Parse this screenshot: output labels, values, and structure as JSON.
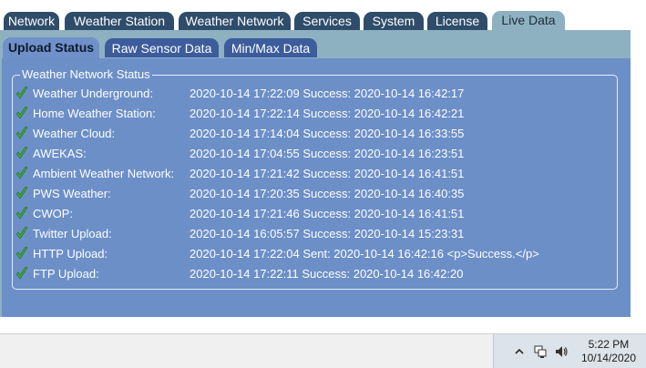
{
  "top_tabs": [
    {
      "label": "Network"
    },
    {
      "label": "Weather Station"
    },
    {
      "label": "Weather Network"
    },
    {
      "label": "Services"
    },
    {
      "label": "System"
    },
    {
      "label": "License"
    },
    {
      "label": "Live Data"
    }
  ],
  "active_top_tab": "Live Data",
  "sub_tabs": [
    {
      "label": "Upload Status"
    },
    {
      "label": "Raw Sensor Data"
    },
    {
      "label": "Min/Max Data"
    }
  ],
  "active_sub_tab": "Upload Status",
  "status": {
    "legend": "Weather Network Status",
    "rows": [
      {
        "label": "Weather Underground:",
        "value": "2020-10-14 17:22:09 Success: 2020-10-14 16:42:17"
      },
      {
        "label": "Home Weather Station:",
        "value": "2020-10-14 17:22:14 Success: 2020-10-14 16:42:21"
      },
      {
        "label": "Weather Cloud:",
        "value": "2020-10-14 17:14:04 Success: 2020-10-14 16:33:55"
      },
      {
        "label": "AWEKAS:",
        "value": "2020-10-14 17:04:55 Success: 2020-10-14 16:23:51"
      },
      {
        "label": "Ambient Weather Network:",
        "value": "2020-10-14 17:21:42 Success: 2020-10-14 16:41:51"
      },
      {
        "label": "PWS Weather:",
        "value": "2020-10-14 17:20:35 Success: 2020-10-14 16:40:35"
      },
      {
        "label": "CWOP:",
        "value": "2020-10-14 17:21:46 Success: 2020-10-14 16:41:51"
      },
      {
        "label": "Twitter Upload:",
        "value": "2020-10-14 16:05:57 Success: 2020-10-14 15:23:31"
      },
      {
        "label": "HTTP Upload:",
        "value": "2020-10-14 17:22:04 Sent: 2020-10-14 16:42:16 <p>Success.</p>"
      },
      {
        "label": "FTP Upload:",
        "value": "2020-10-14 17:22:11 Success: 2020-10-14 16:42:20"
      }
    ]
  },
  "taskbar": {
    "time": "5:22 PM",
    "date": "10/14/2020",
    "tray_icons": [
      "chevron-up-icon",
      "network-icon",
      "speaker-icon"
    ]
  },
  "colors": {
    "tab_dark": "#2f4d6a",
    "tab_active": "#8eb1c2",
    "subtab": "#3c5c9c",
    "content_bg": "#6c8fc8",
    "check_green": "#3fa83a"
  }
}
